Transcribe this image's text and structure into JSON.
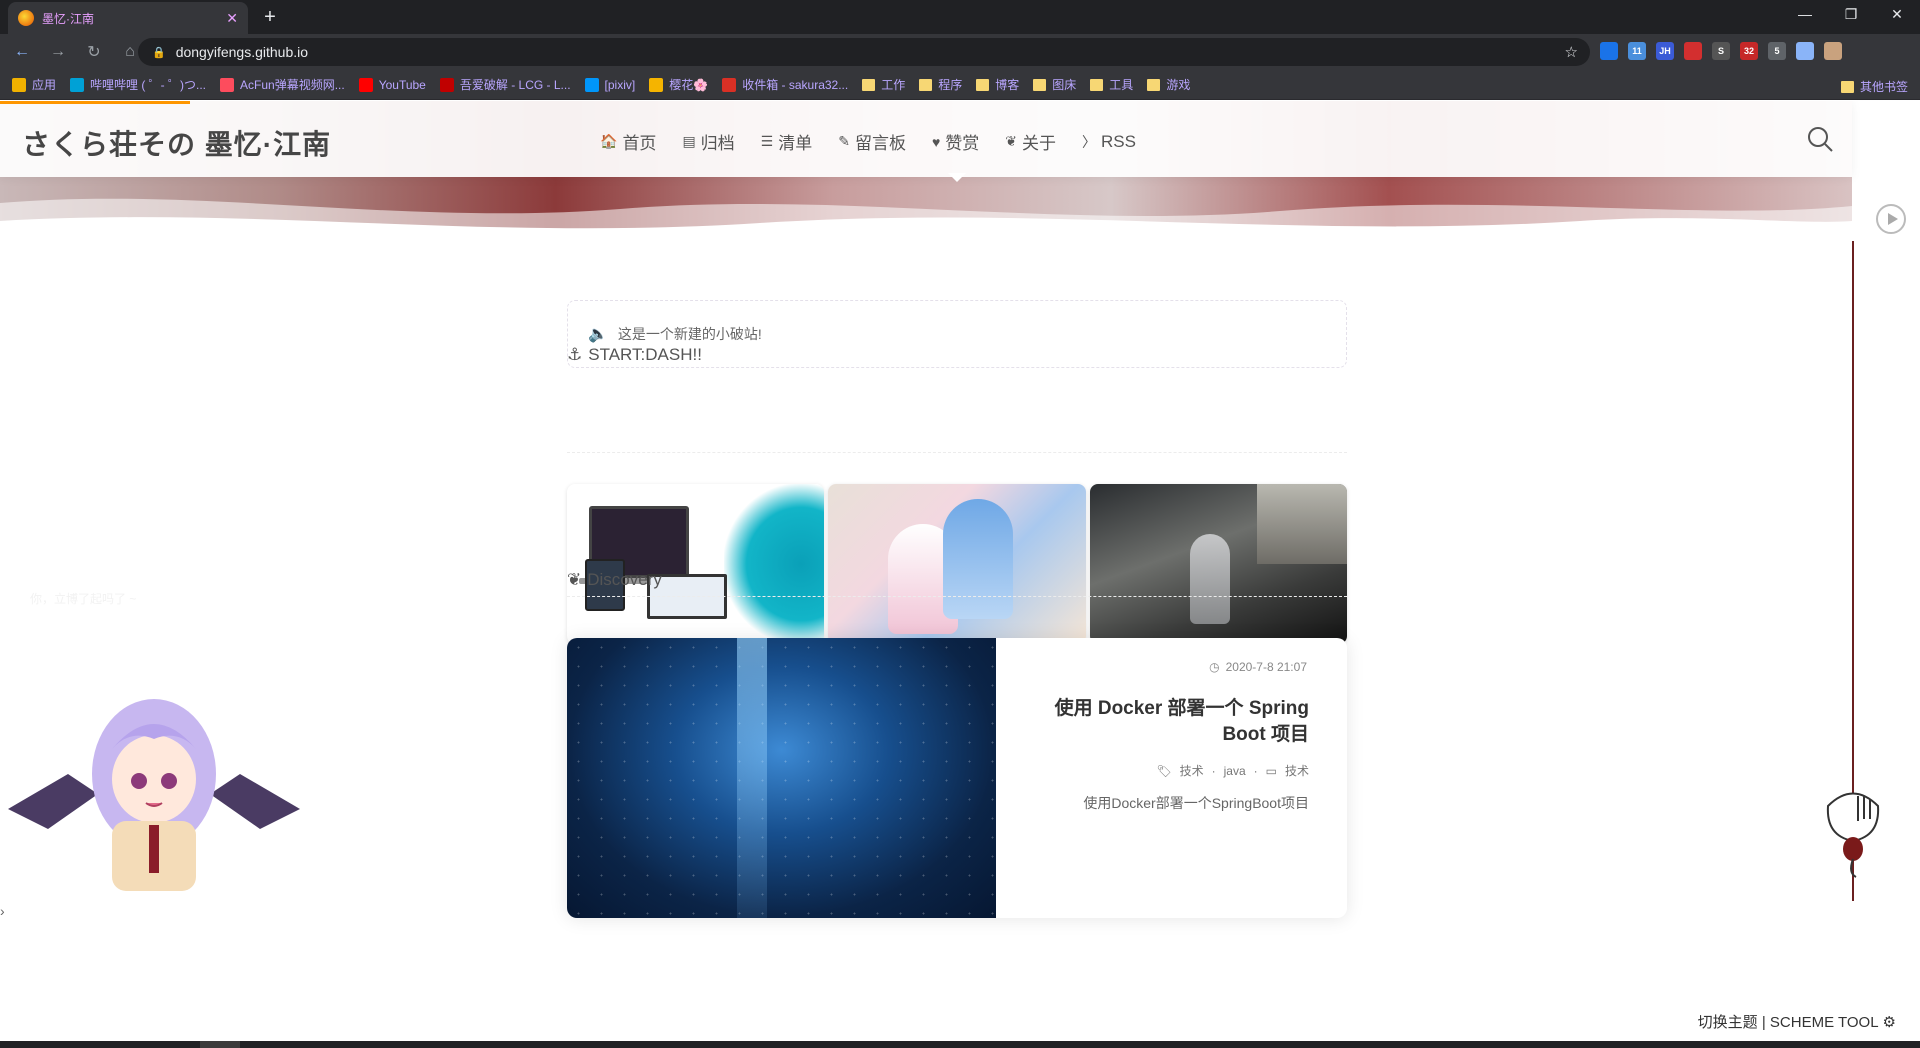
{
  "browser": {
    "tab_title": "墨忆·江南",
    "url": "dongyifengs.github.io",
    "bookmarks": [
      {
        "label": "应用",
        "color": "#f0b100"
      },
      {
        "label": "哔哩哔哩 ( ゜- ゜)つ...",
        "color": "#00a1d6"
      },
      {
        "label": "AcFun弹幕视频网...",
        "color": "#fd4c5d"
      },
      {
        "label": "YouTube",
        "color": "#ff0000"
      },
      {
        "label": "吾爱破解 - LCG - L...",
        "color": "#c00000"
      },
      {
        "label": "[pixiv]",
        "color": "#0096fa"
      },
      {
        "label": "樱花🌸",
        "color": "#f5b400"
      },
      {
        "label": "收件箱 - sakura32...",
        "color": "#d93025"
      },
      {
        "label": "工作",
        "color": "folder"
      },
      {
        "label": "程序",
        "color": "folder"
      },
      {
        "label": "博客",
        "color": "folder"
      },
      {
        "label": "图床",
        "color": "folder"
      },
      {
        "label": "工具",
        "color": "folder"
      },
      {
        "label": "游戏",
        "color": "folder"
      }
    ],
    "other_bookmarks": "其他书签",
    "extensions": [
      {
        "label": "",
        "color": "#1a73e8"
      },
      {
        "label": "11",
        "color": "#4a8fdc"
      },
      {
        "label": "JH",
        "color": "#3b5bd6"
      },
      {
        "label": "",
        "color": "#d32f2f"
      },
      {
        "label": "S",
        "color": "#555"
      },
      {
        "label": "32",
        "color": "#c62828"
      },
      {
        "label": "5",
        "color": "#5f6368"
      },
      {
        "label": "",
        "color": "#8ab4f8"
      },
      {
        "label": "",
        "color": "#c9a27e"
      }
    ]
  },
  "site": {
    "title": "さくら荘その 墨忆·江南",
    "nav": [
      {
        "label": "首页",
        "icon": "home-icon",
        "glyph": "🏠"
      },
      {
        "label": "归档",
        "icon": "archive-icon",
        "glyph": "▤"
      },
      {
        "label": "清单",
        "icon": "list-icon",
        "glyph": "☰"
      },
      {
        "label": "留言板",
        "icon": "edit-icon",
        "glyph": "✎"
      },
      {
        "label": "赞赏",
        "icon": "heart-icon",
        "glyph": "♥"
      },
      {
        "label": "关于",
        "icon": "leaf-icon",
        "glyph": "❦"
      },
      {
        "label": "RSS",
        "icon": "rss-icon",
        "glyph": "〉"
      }
    ]
  },
  "notice": {
    "text": "这是一个新建的小破站!"
  },
  "sections": {
    "start_dash": "START:DASH!!",
    "discovery": "Discovery"
  },
  "left_faded_text": "你，立博了起吗了 ~",
  "post": {
    "date": "2020-7-8 21:07",
    "title": "使用 Docker 部署一个 Spring Boot 项目",
    "tags": [
      "技术",
      "java"
    ],
    "category": "技术",
    "excerpt": "使用Docker部署一个SpringBoot项目"
  },
  "scheme_tool": "切换主题 | SCHEME TOOL"
}
